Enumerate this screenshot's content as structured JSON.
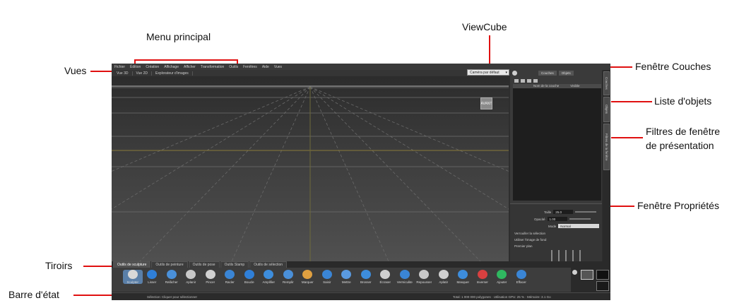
{
  "callouts": {
    "menu_principal": "Menu principal",
    "viewcube": "ViewCube",
    "vues": "Vues",
    "fenetre_couches": "Fenêtre Couches",
    "liste_objets": "Liste d'objets",
    "filtres_line1": "Filtres de fenêtre",
    "filtres_line2": "de présentation",
    "fenetre_proprietes": "Fenêtre Propriétés",
    "tiroirs": "Tiroirs",
    "barre_etat": "Barre d'état"
  },
  "colors": {
    "callout_line": "#e01010",
    "app_background": "#2e2e2e"
  },
  "app": {
    "menu_items": [
      "Fichier",
      "Édition",
      "Création",
      "Affichage",
      "Afficher",
      "Transformation",
      "Outils",
      "Fenêtres",
      "Aide",
      "Vues"
    ],
    "view_tabs": [
      "Vue 3D",
      "Vue 2D",
      "Explorateur d'images"
    ],
    "camera_select": "Caméra par défaut",
    "viewcube_label": "AVANT",
    "layer_tabs": [
      "Couches",
      "Objets"
    ],
    "layer_columns": [
      "Nom de la couche",
      "Visible"
    ],
    "side_tabs": [
      "Couches",
      "Objets",
      "Filtres de la fenêtre"
    ],
    "properties": {
      "rows": [
        {
          "label": "Taille",
          "value": "25.0"
        },
        {
          "label": "Opacité",
          "value": "1.00"
        },
        {
          "label": "Mode",
          "value": "Normal"
        }
      ],
      "options": [
        "Verrouiller la sélection",
        "Utiliser l'image de fond",
        "Premier plan"
      ]
    },
    "drawer_tabs": [
      "Outils de sculpture",
      "Outils de peinture",
      "Outils de pose",
      "Outils Stamp",
      "Outils de sélection"
    ],
    "tools": [
      {
        "label": "Sculpter",
        "icon": "sculpt-icon",
        "color": "#d8d8d8"
      },
      {
        "label": "Lisser",
        "icon": "smooth-icon",
        "color": "#2f7fd8"
      },
      {
        "label": "Relâcher",
        "icon": "relax-icon",
        "color": "#4a90d9"
      },
      {
        "label": "Aplanir",
        "icon": "flatten-icon",
        "color": "#c8c8c8"
      },
      {
        "label": "Pincer",
        "icon": "pinch-icon",
        "color": "#d0d0d0"
      },
      {
        "label": "Racler",
        "icon": "scrape-icon",
        "color": "#3a85d5"
      },
      {
        "label": "Boucle",
        "icon": "bulge-icon",
        "color": "#2f7fd8"
      },
      {
        "label": "Amplifier",
        "icon": "amplify-icon",
        "color": "#3d8ddc"
      },
      {
        "label": "Remplir",
        "icon": "fill-icon",
        "color": "#4a8fd8"
      },
      {
        "label": "Marquer",
        "icon": "imprint-icon",
        "color": "#e0a040"
      },
      {
        "label": "Saisir",
        "icon": "grab-icon",
        "color": "#3a85d5"
      },
      {
        "label": "Mettre",
        "icon": "knife-icon",
        "color": "#5a9ae0"
      },
      {
        "label": "Brosser",
        "icon": "spray-icon",
        "color": "#3d8ddc"
      },
      {
        "label": "Écraser",
        "icon": "smear-icon",
        "color": "#d0d0d0"
      },
      {
        "label": "Vermiculite",
        "icon": "wax-icon",
        "color": "#3a85d5"
      },
      {
        "label": "Repousser",
        "icon": "repeat-icon",
        "color": "#c8c8c8"
      },
      {
        "label": "Aplatir",
        "icon": "erase-icon",
        "color": "#d0d0d0"
      },
      {
        "label": "Masquer",
        "icon": "mask-icon",
        "color": "#3d8ddc"
      },
      {
        "label": "Inverser",
        "icon": "invert-icon",
        "color": "#d84040"
      },
      {
        "label": "Ajouter",
        "icon": "add-icon",
        "color": "#2fb860"
      },
      {
        "label": "Effacer",
        "icon": "clear-icon",
        "color": "#3a85d5"
      }
    ],
    "status_left": "Sélection: Cliquer pour sélectionner",
    "status_right": "Total: 1 000 000 polygones · Utilisation GPU: 25 % · Mémoire: 3.1 Go"
  }
}
